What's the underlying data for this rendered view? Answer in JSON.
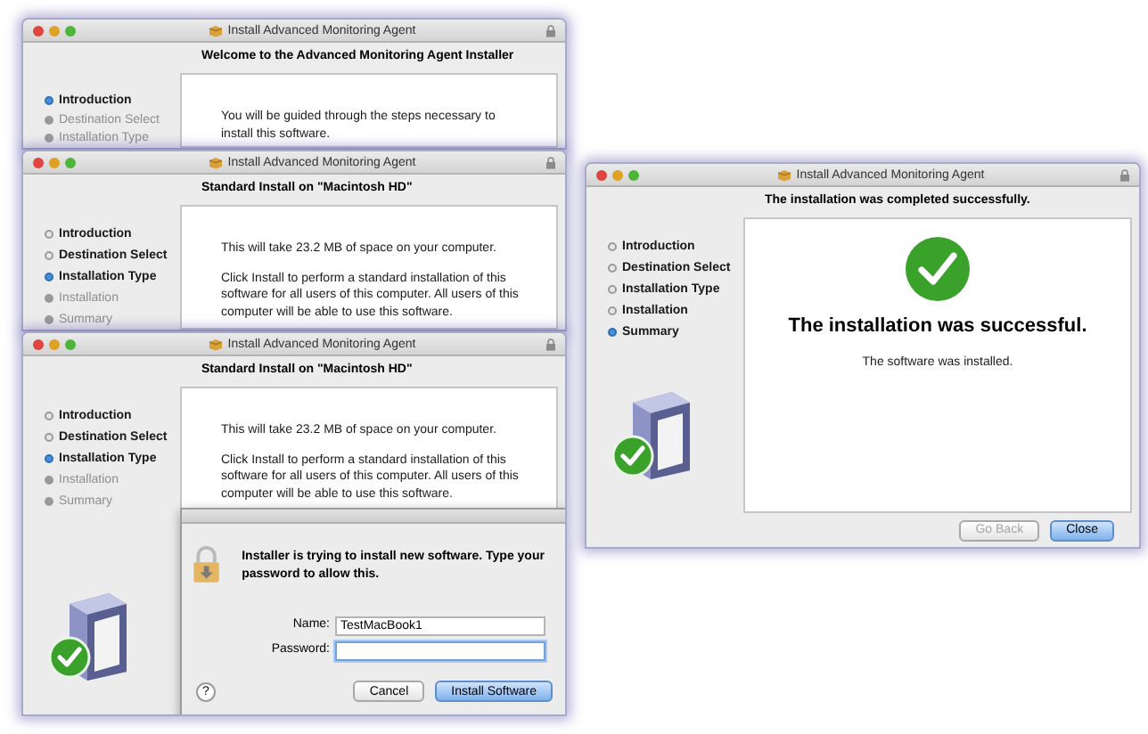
{
  "windows": [
    {
      "title": "Install Advanced Monitoring Agent",
      "heading": "Welcome to the Advanced Monitoring Agent Installer",
      "steps": [
        {
          "label": "Introduction",
          "selected": true,
          "completed": false
        },
        {
          "label": "Destination Select",
          "selected": false,
          "completed": false
        },
        {
          "label": "Installation Type",
          "selected": false,
          "completed": false
        }
      ],
      "content": {
        "kind": "text",
        "paragraphs": [
          "You will be guided through the steps necessary to install this software."
        ]
      },
      "drive_icon": false
    },
    {
      "title": "Install Advanced Monitoring Agent",
      "heading": "Standard Install on \"Macintosh HD\"",
      "steps": [
        {
          "label": "Introduction",
          "selected": false,
          "completed": true
        },
        {
          "label": "Destination Select",
          "selected": false,
          "completed": true
        },
        {
          "label": "Installation Type",
          "selected": true,
          "completed": false
        },
        {
          "label": "Installation",
          "selected": false,
          "completed": false
        },
        {
          "label": "Summary",
          "selected": false,
          "completed": false
        }
      ],
      "content": {
        "kind": "text",
        "paragraphs": [
          "This will take 23.2 MB of space on your computer.",
          "Click Install to perform a standard installation of this software for all users of this computer. All users of this computer will be able to use this software."
        ]
      },
      "drive_icon": false
    },
    {
      "title": "Install Advanced Monitoring Agent",
      "heading": "Standard Install on \"Macintosh HD\"",
      "steps": [
        {
          "label": "Introduction",
          "selected": false,
          "completed": true
        },
        {
          "label": "Destination Select",
          "selected": false,
          "completed": true
        },
        {
          "label": "Installation Type",
          "selected": true,
          "completed": false
        },
        {
          "label": "Installation",
          "selected": false,
          "completed": false
        },
        {
          "label": "Summary",
          "selected": false,
          "completed": false
        }
      ],
      "content": {
        "kind": "text",
        "paragraphs": [
          "This will take 23.2 MB of space on your computer.",
          "Click Install to perform a standard installation of this software for all users of this computer. All users of this computer will be able to use this software."
        ]
      },
      "drive_icon": true,
      "dialog": {
        "message": "Installer is trying to install new software. Type your password to allow this.",
        "fields": [
          {
            "label": "Name:",
            "value": "TestMacBook1",
            "focused": false
          },
          {
            "label": "Password:",
            "focused": true
          }
        ],
        "help": "?",
        "buttons": [
          {
            "label": "Cancel",
            "default": false,
            "disabled": false
          },
          {
            "label": "Install Software",
            "default": true,
            "disabled": false
          }
        ]
      }
    },
    {
      "title": "Install Advanced Monitoring Agent",
      "heading": "The installation was completed successfully.",
      "steps": [
        {
          "label": "Introduction",
          "selected": false,
          "completed": true
        },
        {
          "label": "Destination Select",
          "selected": false,
          "completed": true
        },
        {
          "label": "Installation Type",
          "selected": false,
          "completed": true
        },
        {
          "label": "Installation",
          "selected": false,
          "completed": true
        },
        {
          "label": "Summary",
          "selected": true,
          "completed": false
        }
      ],
      "content": {
        "kind": "success",
        "headline": "The installation was successful.",
        "message": "The software was installed."
      },
      "drive_icon": true,
      "buttons": [
        {
          "label": "Go Back",
          "default": false,
          "disabled": true
        },
        {
          "label": "Close",
          "default": true,
          "disabled": false
        }
      ]
    }
  ]
}
